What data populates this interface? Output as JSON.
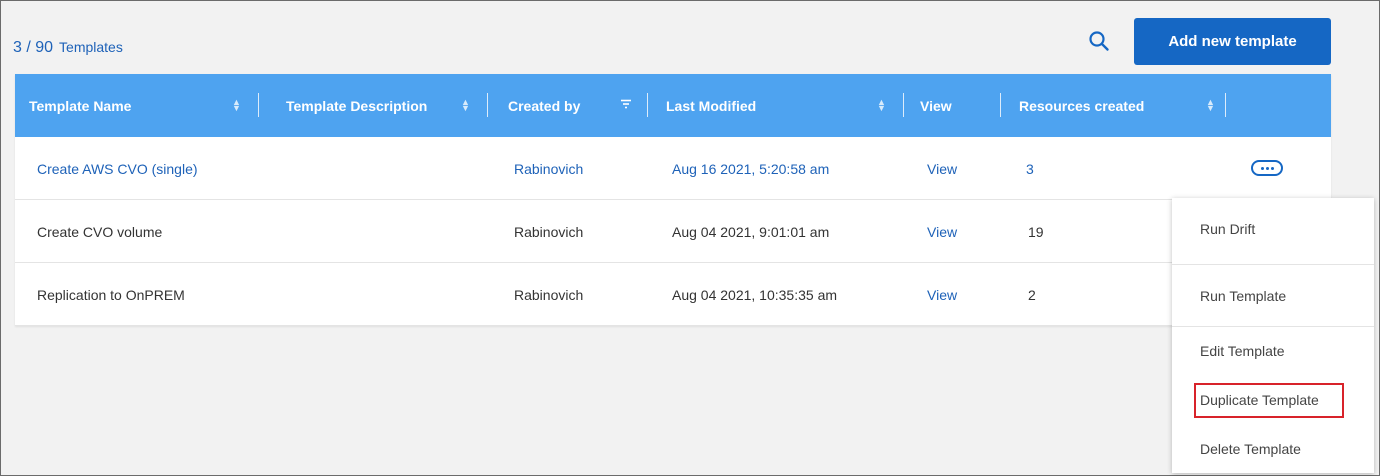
{
  "header": {
    "count": "3 / 90",
    "count_label": "Templates",
    "add_button": "Add new template"
  },
  "table": {
    "columns": [
      "Template Name",
      "Template Description",
      "Created by",
      "Last Modified",
      "View",
      "Resources created"
    ],
    "rows": [
      {
        "name": "Create AWS CVO (single)",
        "description": "",
        "created_by": "Rabinovich",
        "modified": "Aug 16 2021, 5:20:58 am",
        "view": "View",
        "resources": "3"
      },
      {
        "name": "Create CVO volume",
        "description": "",
        "created_by": "Rabinovich",
        "modified": "Aug 04 2021, 9:01:01 am",
        "view": "View",
        "resources": "19"
      },
      {
        "name": "Replication to OnPREM",
        "description": "",
        "created_by": "Rabinovich",
        "modified": "Aug 04 2021, 10:35:35 am",
        "view": "View",
        "resources": "2"
      }
    ]
  },
  "menu": {
    "items": [
      "Run Drift",
      "Run Template",
      "Edit Template",
      "Duplicate Template",
      "Delete Template"
    ],
    "highlighted": "Duplicate Template"
  },
  "colors": {
    "header_bg": "#4ea3f0",
    "primary": "#1567c4",
    "link": "#1e62b8",
    "highlight_border": "#d8232a"
  },
  "icons": {
    "search": "search-icon",
    "sort": "sort-icon",
    "filter": "filter-icon",
    "more": "more-options-icon"
  }
}
